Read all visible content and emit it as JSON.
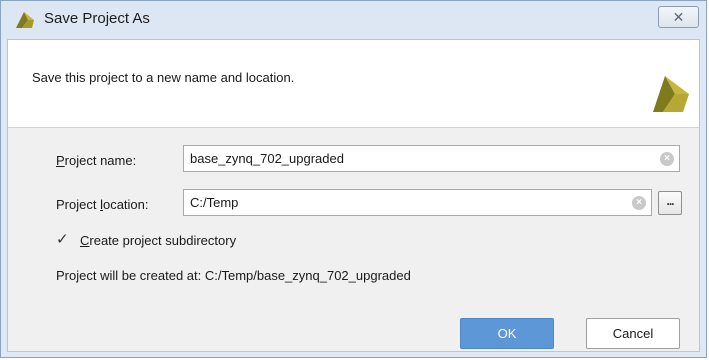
{
  "window": {
    "title": "Save Project As",
    "close_symbol": "✕"
  },
  "header": {
    "description": "Save this project to a new name and location."
  },
  "form": {
    "project_name": {
      "label_mnemonic": "P",
      "label_rest": "roject name:",
      "value": "base_zynq_702_upgraded"
    },
    "project_location": {
      "label_before": "Project ",
      "label_mnemonic": "l",
      "label_rest": "ocation:",
      "value": "C:/Temp",
      "browse_label": "..."
    },
    "subdirectory": {
      "checked": true,
      "check_symbol": "✓",
      "label_mnemonic": "C",
      "label_rest": "reate project subdirectory"
    },
    "created_at_text": "Project will be created at: C:/Temp/base_zynq_702_upgraded"
  },
  "buttons": {
    "ok_label": "OK",
    "cancel_label": "Cancel"
  },
  "icons": {
    "app_logo": "vivado-logo-icon",
    "clear": "clear-circle-icon",
    "close": "close-icon"
  },
  "colors": {
    "ok_button": "#5d97d8",
    "logo_dark": "#7a7a1a",
    "logo_light": "#c8b63c"
  }
}
